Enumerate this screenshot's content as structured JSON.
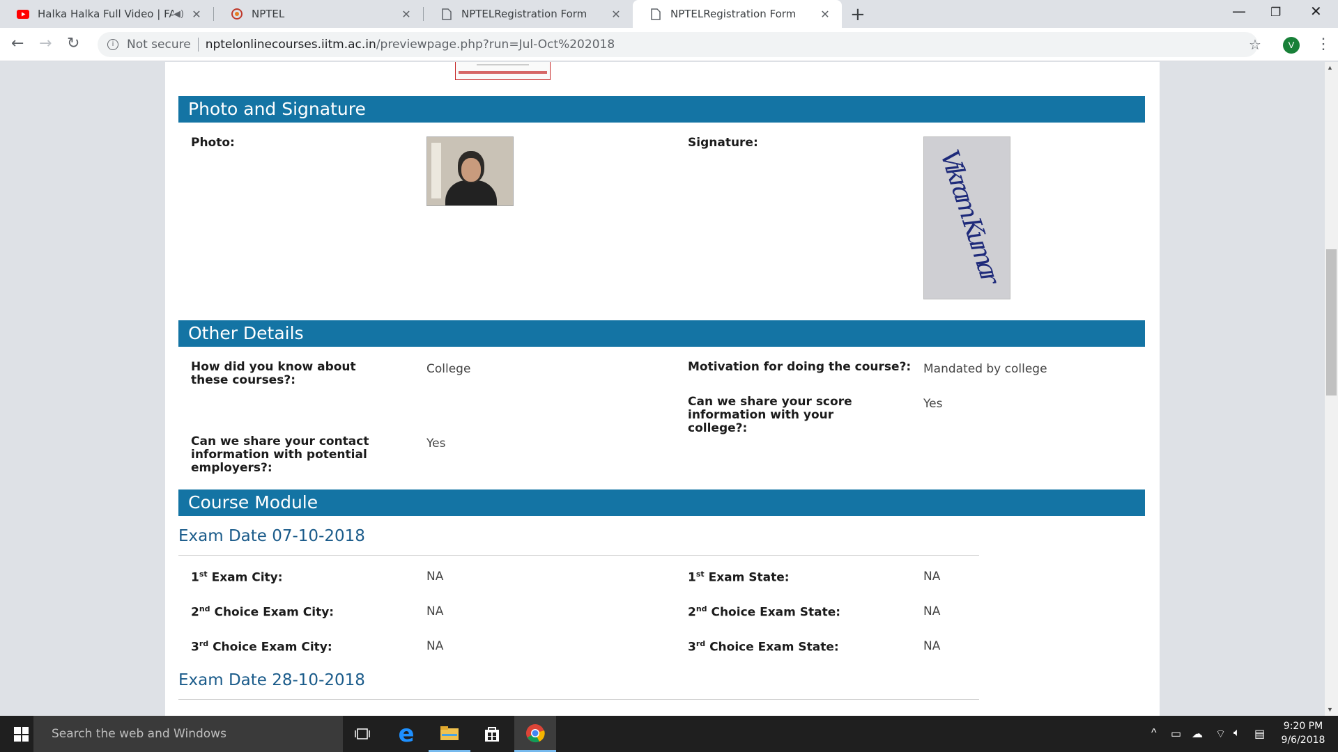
{
  "browser": {
    "tabs": [
      {
        "title": "Halka Halka Full Video | FANNEY KHAN",
        "favicon": "youtube-icon",
        "audio": true
      },
      {
        "title": "NPTEL",
        "favicon": "nptel-logo-icon"
      },
      {
        "title": "NPTELRegistration Form",
        "favicon": "page-icon"
      },
      {
        "title": "NPTELRegistration Form",
        "favicon": "page-icon",
        "active": true
      }
    ],
    "security_label": "Not secure",
    "url_host": "nptelonlinecourses.iitm.ac.in",
    "url_path": "/previewpage.php?run=Jul-Oct%202018",
    "profile_initial": "V"
  },
  "photo_signature": {
    "header": "Photo and Signature",
    "photo_label": "Photo:",
    "signature_label": "Signature:",
    "signature_text": "Vikram Kumar"
  },
  "other_details": {
    "header": "Other Details",
    "know_label": "How did you know about these courses?:",
    "know_value": "College",
    "motivation_label": "Motivation for doing the course?:",
    "motivation_value": "Mandated by college",
    "share_score_label": "Can we share your score information with your college?:",
    "share_score_value": "Yes",
    "share_contact_label": "Can we share your contact information with potential employers?:",
    "share_contact_value": "Yes"
  },
  "course_module": {
    "header": "Course Module",
    "exam1": {
      "title": "Exam Date 07-10-2018",
      "city1_num": "1",
      "city1_sup": "st",
      "city1_label": " Exam City:",
      "city1_value": "NA",
      "state1_num": "1",
      "state1_sup": "st",
      "state1_label": " Exam State:",
      "state1_value": "NA",
      "city2_num": "2",
      "city2_sup": "nd",
      "city2_label": " Choice Exam City:",
      "city2_value": "NA",
      "state2_num": "2",
      "state2_sup": "nd",
      "state2_label": " Choice Exam State:",
      "state2_value": "NA",
      "city3_num": "3",
      "city3_sup": "rd",
      "city3_label": " Choice Exam City:",
      "city3_value": "NA",
      "state3_num": "3",
      "state3_sup": "rd",
      "state3_label": " Choice Exam State:",
      "state3_value": "NA"
    },
    "exam2": {
      "title": "Exam Date 28-10-2018"
    }
  },
  "taskbar": {
    "search_placeholder": "Search the web and Windows",
    "time": "9:20 PM",
    "date": "9/6/2018"
  },
  "colors": {
    "section_header": "#1474a4",
    "subheading": "#1a5b8a"
  }
}
